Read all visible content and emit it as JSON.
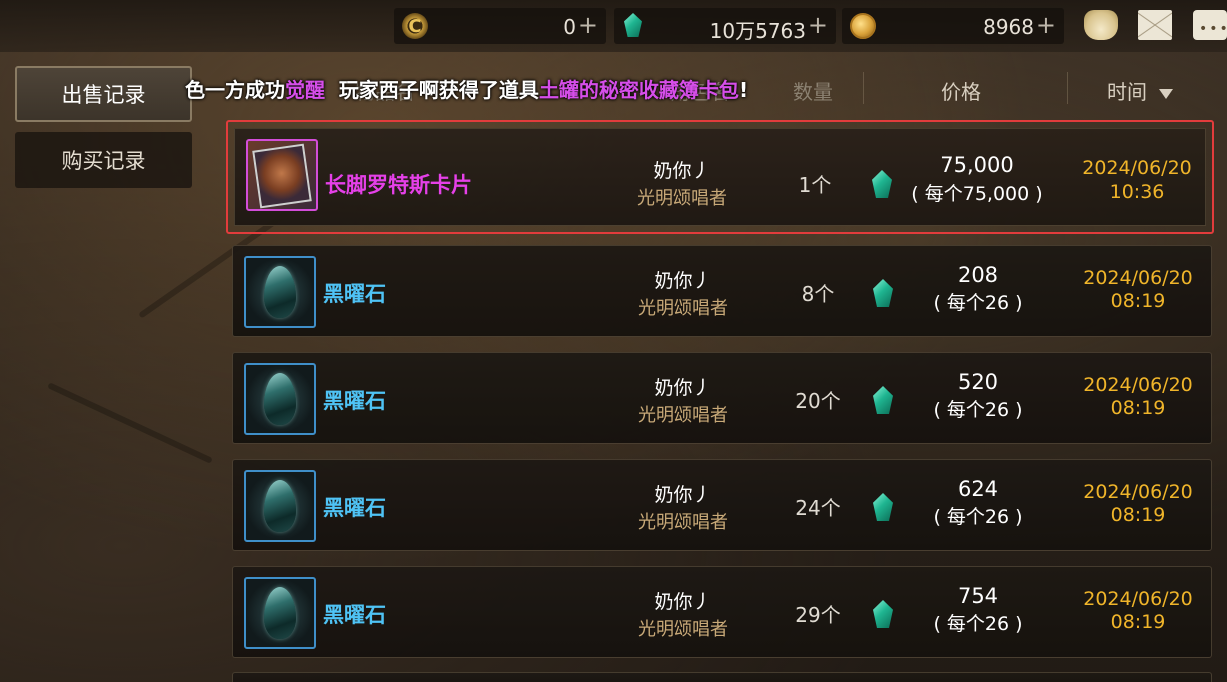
{
  "resources": [
    {
      "icon": "c-currency-icon",
      "value": "0"
    },
    {
      "icon": "gem-icon",
      "value": "10万5763"
    },
    {
      "icon": "gold-coin-icon",
      "value": "8968"
    }
  ],
  "plus_symbol": "+",
  "top_icons": [
    "pouch-icon",
    "mail-icon",
    "chat-icon"
  ],
  "tabs": [
    {
      "label": "出售记录",
      "active": true
    },
    {
      "label": "购买记录",
      "active": false
    }
  ],
  "ticker": {
    "prefix": "色一方成功",
    "awaken": "觉醒",
    "mid": "  玩家西子啊获得了道具",
    "item": "土罐的秘密收藏簿卡包",
    "suffix": "!"
  },
  "header": {
    "item_col": "物品名",
    "seller_col": "角色名",
    "qty_col": "数量",
    "price_col": "价格",
    "time_col": "时间"
  },
  "rows": [
    {
      "item_name": "长脚罗特斯卡片",
      "item_type": "card",
      "seller": "奶你丿",
      "seller_title": "光明颂唱者",
      "qty": "1个",
      "total": "75,000",
      "each": "( 每个75,000 )",
      "date": "2024/06/20",
      "time": "10:36"
    },
    {
      "item_name": "黑曜石",
      "item_type": "stone",
      "seller": "奶你丿",
      "seller_title": "光明颂唱者",
      "qty": "8个",
      "total": "208",
      "each": "( 每个26 )",
      "date": "2024/06/20",
      "time": "08:19"
    },
    {
      "item_name": "黑曜石",
      "item_type": "stone",
      "seller": "奶你丿",
      "seller_title": "光明颂唱者",
      "qty": "20个",
      "total": "520",
      "each": "( 每个26 )",
      "date": "2024/06/20",
      "time": "08:19"
    },
    {
      "item_name": "黑曜石",
      "item_type": "stone",
      "seller": "奶你丿",
      "seller_title": "光明颂唱者",
      "qty": "24个",
      "total": "624",
      "each": "( 每个26 )",
      "date": "2024/06/20",
      "time": "08:19"
    },
    {
      "item_name": "黑曜石",
      "item_type": "stone",
      "seller": "奶你丿",
      "seller_title": "光明颂唱者",
      "qty": "29个",
      "total": "754",
      "each": "( 每个26 )",
      "date": "2024/06/20",
      "time": "08:19"
    }
  ],
  "colors": {
    "card_name": "#e540e8",
    "stone_name": "#4fc3f5",
    "date": "#f0b52a",
    "highlight_border": "#e23c3c"
  }
}
